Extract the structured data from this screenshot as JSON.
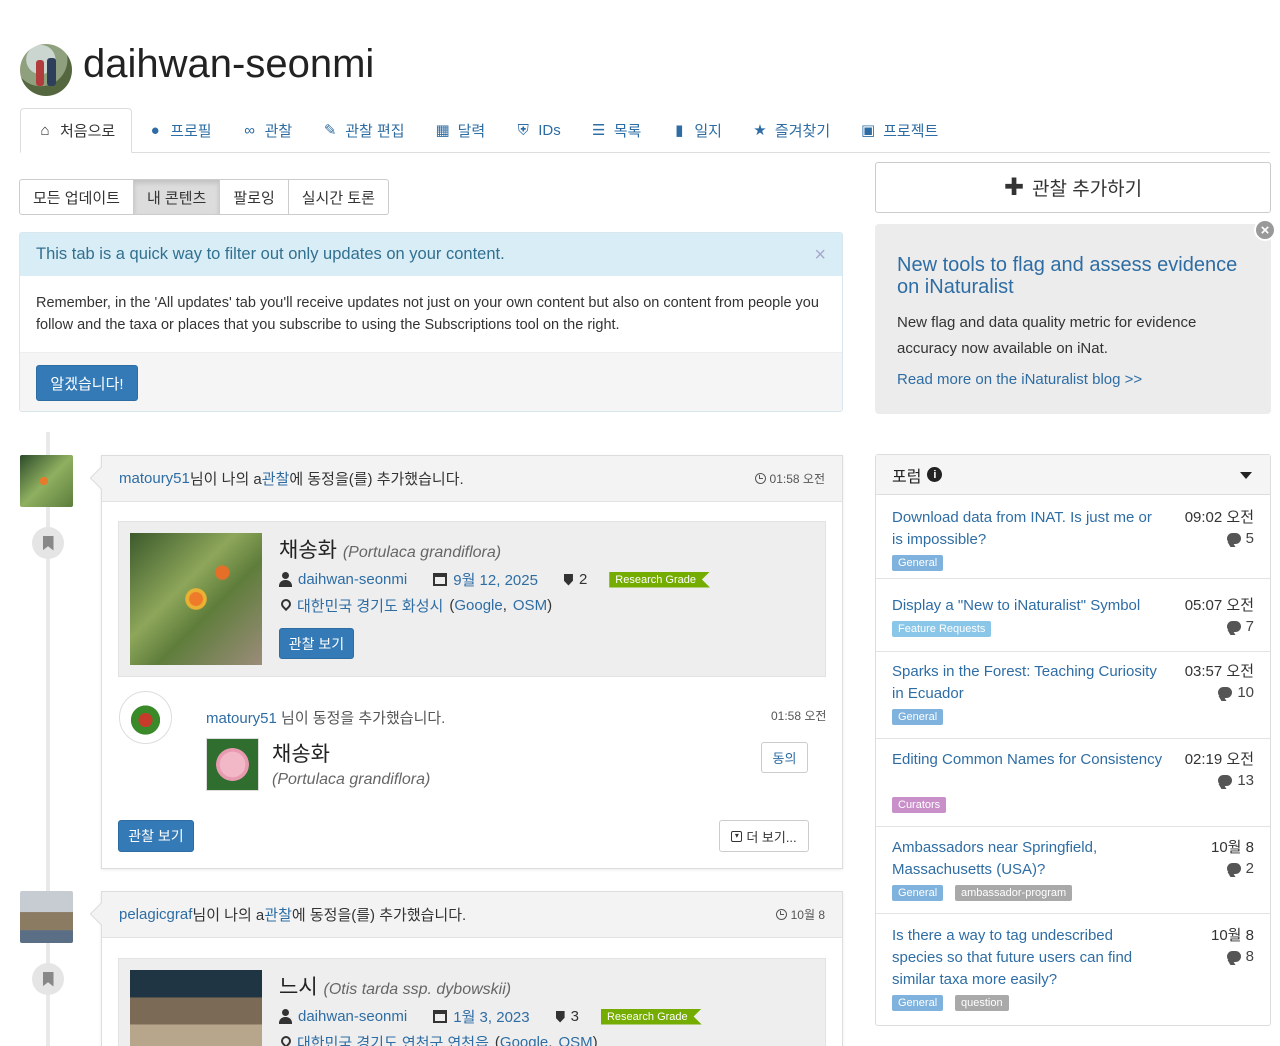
{
  "header": {
    "username": "daihwan-seonmi"
  },
  "tabs": [
    {
      "label": "처음으로",
      "icon": "home-icon",
      "glyph": "⌂"
    },
    {
      "label": "프로필",
      "icon": "user-icon",
      "glyph": "👤"
    },
    {
      "label": "관찰",
      "icon": "binoculars-icon",
      "glyph": "⌘"
    },
    {
      "label": "관찰 편집",
      "icon": "pencil-icon",
      "glyph": "✎"
    },
    {
      "label": "달력",
      "icon": "calendar-icon",
      "glyph": "▦"
    },
    {
      "label": "IDs",
      "icon": "shield-icon",
      "glyph": "⛨"
    },
    {
      "label": "목록",
      "icon": "list-icon",
      "glyph": "☰"
    },
    {
      "label": "일지",
      "icon": "book-icon",
      "glyph": "▮"
    },
    {
      "label": "즐겨찾기",
      "icon": "star-icon",
      "glyph": "★"
    },
    {
      "label": "프로젝트",
      "icon": "briefcase-icon",
      "glyph": "▣"
    }
  ],
  "filters": [
    "모든 업데이트",
    "내 콘텐츠",
    "팔로잉",
    "실시간 토론"
  ],
  "notice": {
    "title": "This tab is a quick way to filter out only updates on your content.",
    "body": "Remember, in the 'All updates' tab you'll receive updates not just on your own content but also on content from people you follow and the taxa or places that you subscribe to using the Subscriptions tool on the right.",
    "button": "알겠습니다!"
  },
  "feed": [
    {
      "user": "matoury51",
      "text_a": "님이 나의 a ",
      "link": "관찰",
      "text_b": "에 동정을(를) 추가했습니다.",
      "time": "01:58 오전",
      "obs": {
        "common": "채송화",
        "sci": "(Portulaca grandiflora)",
        "observer": "daihwan-seonmi",
        "date": "9월 12, 2025",
        "ids": "2",
        "grade": "Research Grade",
        "place": "대한민국 경기도 화성시",
        "google": "Google",
        "osm": "OSM",
        "button": "관찰 보기"
      },
      "ident": {
        "user": "matoury51",
        "text": " 님이 동정을 추가했습니다.",
        "time": "01:58 오전",
        "common": "채송화",
        "sci": "(Portulaca grandiflora)",
        "agree": "동의",
        "view": "관찰 보기",
        "more": "더 보기..."
      }
    },
    {
      "user": "pelagicgraf",
      "text_a": "님이 나의 a ",
      "link": "관찰",
      "text_b": "에 동정을(를) 추가했습니다.",
      "time": "10월 8",
      "obs": {
        "common": "느시",
        "sci": "(Otis tarda ssp. dybowskii)",
        "observer": "daihwan-seonmi",
        "date": "1월 3, 2023",
        "ids": "3",
        "grade": "Research Grade",
        "place": "대한민국 경기도 연천군 연천읍",
        "google": "Google",
        "osm": "OSM"
      }
    }
  ],
  "sidebar": {
    "add_obs": "관찰 추가하기",
    "news": {
      "title": "New tools to flag and assess evidence on iNaturalist",
      "body": "New flag and data quality metric for evidence accuracy now available on iNat.",
      "link": "Read more on the iNaturalist blog >>"
    },
    "forum": {
      "title": "포럼",
      "items": [
        {
          "title": "Download data from INAT. Is just me or is impossible?",
          "time": "09:02 오전",
          "count": "5",
          "tags": [
            {
              "label": "General",
              "color": "#7fb2dd"
            }
          ]
        },
        {
          "title": "Display a \"New to iNaturalist\" Symbol",
          "time": "05:07 오전",
          "count": "7",
          "tags": [
            {
              "label": "Feature Requests",
              "color": "#8ac6e8"
            }
          ]
        },
        {
          "title": "Sparks in the Forest: Teaching Curiosity in Ecuador",
          "time": "03:57 오전",
          "count": "10",
          "tags": [
            {
              "label": "General",
              "color": "#7fb2dd"
            }
          ]
        },
        {
          "title": "Editing Common Names for Consistency",
          "time": "02:19 오전",
          "count": "13",
          "tags": [
            {
              "label": "Curators",
              "color": "#c98fc9"
            }
          ]
        },
        {
          "title": "Ambassadors near Springfield, Massachusetts (USA)?",
          "time": "10월 8",
          "count": "2",
          "tags": [
            {
              "label": "General",
              "color": "#7fb2dd"
            },
            {
              "label": "ambassador-program",
              "color": "#a9a9a9"
            }
          ]
        },
        {
          "title": "Is there a way to tag undescribed species so that future users can find similar taxa more easily?",
          "time": "10월 8",
          "count": "8",
          "tags": [
            {
              "label": "General",
              "color": "#7fb2dd"
            },
            {
              "label": "question",
              "color": "#a9a9a9"
            }
          ]
        }
      ]
    }
  }
}
